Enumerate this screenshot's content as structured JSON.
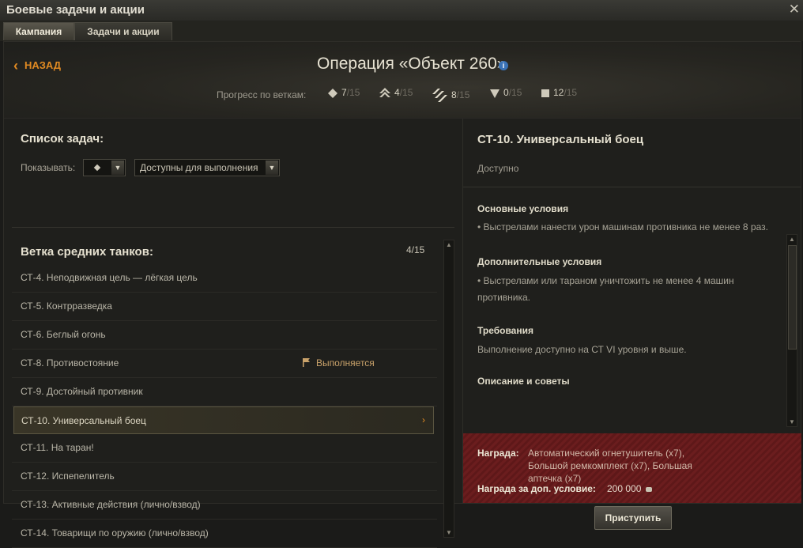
{
  "window": {
    "title": "Боевые задачи и акции",
    "close_icon": "close-icon"
  },
  "tabs": [
    {
      "label": "Кампания",
      "active": true
    },
    {
      "label": "Задачи и акции",
      "active": false
    }
  ],
  "header": {
    "back_label": "НАЗАД",
    "title": "Операция «Объект 260»",
    "info_icon": "i",
    "progress_label": "Прогресс по веткам:",
    "branches": [
      {
        "icon": "light-tank-icon",
        "done": "7",
        "total": "/15"
      },
      {
        "icon": "medium-tank-icon",
        "done": "4",
        "total": "/15"
      },
      {
        "icon": "heavy-tank-icon",
        "done": "8",
        "total": "/15"
      },
      {
        "icon": "tank-destroyer-icon",
        "done": "0",
        "total": "/15"
      },
      {
        "icon": "spg-icon",
        "done": "12",
        "total": "/15"
      }
    ]
  },
  "task_list": {
    "title": "Список задач:",
    "show_label": "Показывать:",
    "type_filter_icon": "medium-tank-icon",
    "status_filter": "Доступны для выполнения",
    "branch_title": "Ветка средних танков:",
    "branch_count": "4/15",
    "tasks": [
      {
        "label": "СТ-4. Неподвижная цель — лёгкая цель"
      },
      {
        "label": "СТ-5. Контрразведка"
      },
      {
        "label": "СТ-6. Беглый огонь"
      },
      {
        "label": "СТ-8. Противостояние",
        "status": "Выполняется"
      },
      {
        "label": "СТ-9. Достойный противник"
      },
      {
        "label": "СТ-10. Универсальный боец",
        "selected": true
      },
      {
        "label": "СТ-11. На таран!"
      },
      {
        "label": "СТ-12. Испепелитель"
      },
      {
        "label": "СТ-13. Активные действия (лично/взвод)"
      },
      {
        "label": "СТ-14. Товарищи по оружию (лично/взвод)"
      }
    ]
  },
  "detail": {
    "title": "СТ-10. Универсальный боец",
    "status": "Доступно",
    "main_conditions_title": "Основные условия",
    "main_conditions_text": "• Выстрелами нанести урон машинам противника не менее 8 раз.",
    "extra_conditions_title": "Дополнительные условия",
    "extra_conditions_text": "• Выстрелами или тараном уничтожить не менее 4 машин противника.",
    "requirements_title": "Требования",
    "requirements_text": "Выполнение доступно на СТ VI уровня и выше.",
    "tips_title": "Описание и советы"
  },
  "reward": {
    "label": "Награда:",
    "text": "Автоматический огнетушитель (x7), Большой ремкомплект (x7), Большая аптечка (x7)",
    "extra_label": "Награда за доп. условие:",
    "extra_value": "200 000",
    "start_button": "Приступить"
  },
  "colors": {
    "accent": "#e08a22",
    "reward_bg": "#6b1d1e",
    "status_in_progress": "#c9a26a"
  }
}
